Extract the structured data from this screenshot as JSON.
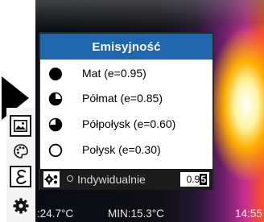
{
  "dialog": {
    "title": "Emisyjność",
    "options": [
      {
        "label": "Mat (e=0.95)",
        "icon": "filled-circle-icon"
      },
      {
        "label": "Półmat (e=0.85)",
        "icon": "three-quarter-filled-circle-icon"
      },
      {
        "label": "Półpołysk (e=0.60)",
        "icon": "half-filled-circle-icon"
      },
      {
        "label": "Połysk (e=0.30)",
        "icon": "empty-circle-icon"
      }
    ],
    "custom": {
      "label": "Indywidualnie",
      "value_prefix": "0.9",
      "value_cursor": "5",
      "icon": "gear-icon"
    }
  },
  "status": {
    "max_temp": ":24.7°C",
    "min_temp": "MIN:15.3°C",
    "time": "14:55"
  },
  "colors": {
    "title_bar": "#1f66ad",
    "selected_row": "#1c1c1c",
    "dialog_bg": "#ffffff"
  }
}
